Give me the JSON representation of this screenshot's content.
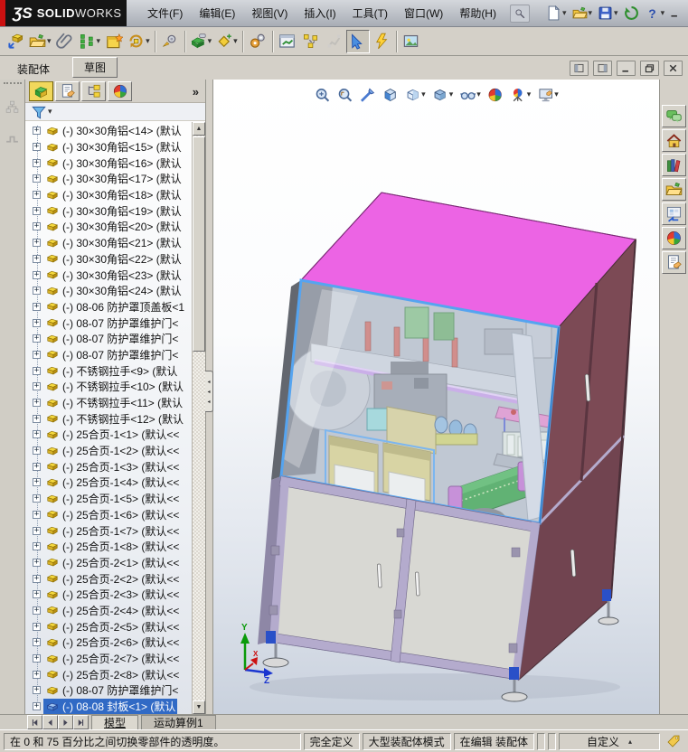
{
  "ui": {
    "dropdown_glyph": "▾",
    "overflow_glyph": "»",
    "collapse_glyph": "◂",
    "plus_glyph": "+",
    "scroll_up_glyph": "▲",
    "scroll_down_glyph": "▼"
  },
  "colors": {
    "selection": "#316ac5",
    "top_pink": "#ec64e4",
    "side_maroon": "#7c4a55",
    "frame_blue": "#55a4f0",
    "conveyor_green": "#2f9e3f",
    "bin_yellow": "#d9cf85",
    "door_gray": "#d8d8d3",
    "cabinet_frame": "#b4abcd"
  },
  "window": {
    "logo": {
      "brand": "ƷS",
      "name_bold": "SOLID",
      "name_rest": "WORKS"
    },
    "buttons": [
      {
        "n": "window-minimize",
        "g": "win-min"
      },
      {
        "n": "window-restore",
        "g": "win-restore"
      },
      {
        "n": "window-close",
        "g": "win-close"
      }
    ]
  },
  "menu": {
    "items": [
      "文件(F)",
      "编辑(E)",
      "视图(V)",
      "插入(I)",
      "工具(T)",
      "窗口(W)",
      "帮助(H)"
    ]
  },
  "quickbar": {
    "icons": [
      {
        "n": "new-document",
        "g": "new-doc",
        "dd": true
      },
      {
        "n": "open-document",
        "g": "folder",
        "dd": true
      },
      {
        "n": "save-document",
        "g": "save",
        "dd": true
      },
      {
        "n": "rebuild",
        "g": "rebuild"
      },
      {
        "n": "help",
        "g": "help",
        "dd": true
      }
    ]
  },
  "assembly_toolbar": {
    "icons": [
      {
        "n": "insert-component",
        "g": "insert-comp"
      },
      {
        "n": "open-part",
        "g": "folder",
        "dd": true
      },
      {
        "n": "mate",
        "g": "paperclip"
      },
      {
        "n": "linear-component-pattern",
        "g": "pattern",
        "dd": true
      },
      {
        "n": "smart-fasteners",
        "g": "star-box"
      },
      {
        "n": "rotate-component",
        "g": "rotate",
        "dd": true
      },
      {
        "n": "move-component",
        "g": "move-gear",
        "sep": true
      },
      {
        "n": "assembly-features",
        "g": "tool-green",
        "dd": true,
        "sep": true
      },
      {
        "n": "reference-geometry",
        "g": "diamond-star",
        "dd": true
      },
      {
        "n": "new-motion-study",
        "g": "gears",
        "sep": true
      },
      {
        "n": "bill-of-materials",
        "g": "window-green",
        "sep": true
      },
      {
        "n": "exploded-view",
        "g": "exploded"
      },
      {
        "n": "explode-line-sketch",
        "g": "explode-sketch",
        "dis": true
      },
      {
        "n": "change-transparency",
        "g": "transparency-pointer",
        "pressed": true
      },
      {
        "n": "simulation-advisor",
        "g": "flash-warn"
      },
      {
        "n": "take-snapshot",
        "g": "photo",
        "sep": true
      }
    ]
  },
  "command_tabs": {
    "tabs": [
      {
        "label": "装配体",
        "active": true
      },
      {
        "label": "草图",
        "active": false
      }
    ]
  },
  "doc_window": {
    "buttons": [
      {
        "n": "pane-preview-left",
        "g": "pane-l"
      },
      {
        "n": "pane-preview-right",
        "g": "pane-r"
      },
      {
        "n": "document-minimize",
        "g": "win-min"
      },
      {
        "n": "document-restore",
        "g": "win-restore"
      },
      {
        "n": "document-close",
        "g": "win-close"
      }
    ]
  },
  "left_strip": {
    "icons": [
      {
        "n": "hierarchy",
        "g": "hierarchy",
        "dis": true
      },
      {
        "n": "step",
        "g": "step",
        "dis": true
      }
    ]
  },
  "feature_panel": {
    "tabs": [
      {
        "n": "featuremanager-tab",
        "g": "featmgr",
        "active": true
      },
      {
        "n": "propertymanager-tab",
        "g": "doc-hand"
      },
      {
        "n": "configurationmanager-tab",
        "g": "configmgr"
      },
      {
        "n": "displaymanager-tab",
        "g": "ball"
      }
    ],
    "filter": [
      {
        "n": "filter",
        "g": "funnel",
        "dd": true
      }
    ],
    "tree": {
      "items": [
        {
          "label": "(-) 30×30角铝<14> (默认"
        },
        {
          "label": "(-) 30×30角铝<15> (默认"
        },
        {
          "label": "(-) 30×30角铝<16> (默认"
        },
        {
          "label": "(-) 30×30角铝<17> (默认"
        },
        {
          "label": "(-) 30×30角铝<18> (默认"
        },
        {
          "label": "(-) 30×30角铝<19> (默认"
        },
        {
          "label": "(-) 30×30角铝<20> (默认"
        },
        {
          "label": "(-) 30×30角铝<21> (默认"
        },
        {
          "label": "(-) 30×30角铝<22> (默认"
        },
        {
          "label": "(-) 30×30角铝<23> (默认"
        },
        {
          "label": "(-) 30×30角铝<24> (默认"
        },
        {
          "label": "(-) 08-06 防护罩顶盖板<1"
        },
        {
          "label": "(-) 08-07 防护罩维护门<"
        },
        {
          "label": "(-) 08-07 防护罩维护门<"
        },
        {
          "label": "(-) 08-07 防护罩维护门<"
        },
        {
          "label": "(-) 不锈钢拉手<9> (默认"
        },
        {
          "label": "(-) 不锈钢拉手<10> (默认"
        },
        {
          "label": "(-) 不锈钢拉手<11> (默认"
        },
        {
          "label": "(-) 不锈钢拉手<12> (默认"
        },
        {
          "label": "(-) 25合页-1<1> (默认<<"
        },
        {
          "label": "(-) 25合页-1<2> (默认<<"
        },
        {
          "label": "(-) 25合页-1<3> (默认<<"
        },
        {
          "label": "(-) 25合页-1<4> (默认<<"
        },
        {
          "label": "(-) 25合页-1<5> (默认<<"
        },
        {
          "label": "(-) 25合页-1<6> (默认<<"
        },
        {
          "label": "(-) 25合页-1<7> (默认<<"
        },
        {
          "label": "(-) 25合页-1<8> (默认<<"
        },
        {
          "label": "(-) 25合页-2<1> (默认<<"
        },
        {
          "label": "(-) 25合页-2<2> (默认<<"
        },
        {
          "label": "(-) 25合页-2<3> (默认<<"
        },
        {
          "label": "(-) 25合页-2<4> (默认<<"
        },
        {
          "label": "(-) 25合页-2<5> (默认<<"
        },
        {
          "label": "(-) 25合页-2<6> (默认<<"
        },
        {
          "label": "(-) 25合页-2<7> (默认<<"
        },
        {
          "label": "(-) 25合页-2<8> (默认<<"
        },
        {
          "label": "(-) 08-07 防护罩维护门<"
        },
        {
          "label": "(-) 08-08 封板<1> (默认",
          "selected": true
        }
      ]
    }
  },
  "viewport": {
    "headsup": [
      {
        "n": "zoom-to-fit",
        "g": "zoom-fit"
      },
      {
        "n": "zoom-to-area",
        "g": "zoom-area"
      },
      {
        "n": "previous-view",
        "g": "wand"
      },
      {
        "n": "section-view",
        "g": "section"
      },
      {
        "n": "view-orientation",
        "g": "orientation",
        "dd": true
      },
      {
        "n": "display-style",
        "g": "display-style",
        "dd": true
      },
      {
        "n": "hide-show-items",
        "g": "glasses",
        "dd": true
      },
      {
        "n": "edit-appearance",
        "g": "ball"
      },
      {
        "n": "apply-scene",
        "g": "scene",
        "dd": true
      },
      {
        "n": "view-settings",
        "g": "monitor-hand",
        "dd": true
      }
    ],
    "triad": {
      "x": "X",
      "y": "Y",
      "z": "Z"
    }
  },
  "task_pane": {
    "icons": [
      {
        "n": "solidworks-forum",
        "g": "bubbles"
      },
      {
        "n": "solidworks-resources",
        "g": "house"
      },
      {
        "n": "design-library",
        "g": "books"
      },
      {
        "n": "file-explorer",
        "g": "folder"
      },
      {
        "n": "view-palette",
        "g": "view-palette"
      },
      {
        "n": "appearances-scenes",
        "g": "ball"
      },
      {
        "n": "custom-properties",
        "g": "doc-hand"
      }
    ]
  },
  "model_tabs": {
    "nav": [
      {
        "n": "go-first",
        "g": "nav-first"
      },
      {
        "n": "go-previous",
        "g": "nav-prev"
      },
      {
        "n": "go-next",
        "g": "nav-next"
      },
      {
        "n": "go-last",
        "g": "nav-last"
      }
    ],
    "tabs": [
      {
        "label": "模型",
        "active": true
      },
      {
        "label": "运动算例1",
        "active": false
      }
    ]
  },
  "statusbar": {
    "message": "在 0 和 75 百分比之间切换零部件的透明度。",
    "fields": [
      "完全定义",
      "大型装配体模式",
      "在编辑 装配体"
    ],
    "custom": "自定义",
    "custom_arrow": "▴",
    "tag": [
      {
        "n": "tag",
        "g": "tag"
      }
    ]
  }
}
